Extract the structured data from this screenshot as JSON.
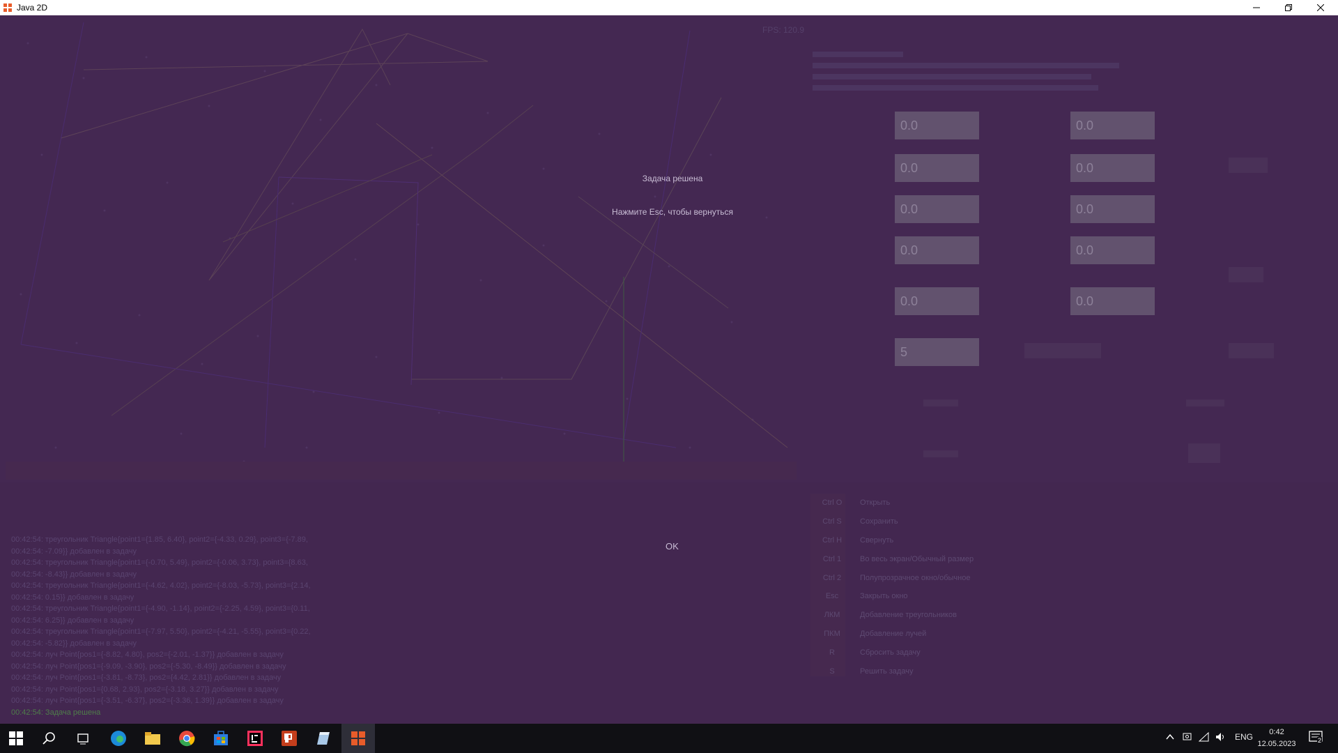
{
  "window": {
    "title": "Java 2D"
  },
  "canvas": {
    "fps": "FPS: 120.9",
    "status_title": "Задача решена",
    "status_hint": "Нажмите Esc, чтобы вернуться",
    "ok_label": "OK"
  },
  "panel": {
    "fields": [
      "0.0",
      "0.0",
      "0.0",
      "0.0",
      "0.0",
      "0.0",
      "0.0",
      "0.0",
      "0.0",
      "0.0",
      "5"
    ]
  },
  "hotkeys": [
    {
      "key": "Ctrl O",
      "desc": "Открыть"
    },
    {
      "key": "Ctrl S",
      "desc": "Сохранить"
    },
    {
      "key": "Ctrl H",
      "desc": "Свернуть"
    },
    {
      "key": "Ctrl 1",
      "desc": "Во весь экран/Обычный размер"
    },
    {
      "key": "Ctrl 2",
      "desc": "Полупрозрачное окно/обычное"
    },
    {
      "key": "Esc",
      "desc": "Закрыть окно"
    },
    {
      "key": "ЛКМ",
      "desc": "Добавление треугольников"
    },
    {
      "key": "ПКМ",
      "desc": "Добавление лучей"
    },
    {
      "key": "R",
      "desc": "Сбросить задачу"
    },
    {
      "key": "S",
      "desc": "Решить задачу"
    }
  ],
  "log": [
    "00:42:54: треугольник Triangle{point1={1.85, 6.40}, point2={-4.33, 0.29}, point3={-7.89,",
    "00:42:54: -7.09}} добавлен в задачу",
    "00:42:54: треугольник Triangle{point1={-0.70, 5.49}, point2={-0.06, 3.73}, point3={8.63,",
    "00:42:54: -8.43}} добавлен в задачу",
    "00:42:54: треугольник Triangle{point1={-4.62, 4.02}, point2={-8.03, -5.73}, point3={2.14,",
    "00:42:54: 0.15}} добавлен в задачу",
    "00:42:54: треугольник Triangle{point1={-4.90, -1.14}, point2={-2.25, 4.59}, point3={0.11,",
    "00:42:54: 6.25}} добавлен в задачу",
    "00:42:54: треугольник Triangle{point1={-7.97, 5.50}, point2={-4.21, -5.55}, point3={0.22,",
    "00:42:54: -5.82}} добавлен в задачу",
    "00:42:54: луч Point{pos1={-8.82, 4.80}, pos2={-2.01, -1.37}} добавлен в задачу",
    "00:42:54: луч Point{pos1={-9.09, -3.90}, pos2={-5.30, -8.49}} добавлен в задачу",
    "00:42:54: луч Point{pos1={-3.81, -8.73}, pos2={4.42, 2.81}} добавлен в задачу",
    "00:42:54: луч Point{pos1={0.68, 2.93}, pos2={-3.18, 3.27}} добавлен в задачу",
    "00:42:54: луч Point{pos1={-3.51, -6.37}, pos2={-3.36, 1.39}} добавлен в задачу",
    "00:42:54: Задача решена"
  ],
  "taskbar": {
    "lang": "ENG",
    "time": "0:42",
    "date": "12.05.2023",
    "notifications": "2",
    "apps": [
      "start-icon",
      "search-icon",
      "task-view-icon",
      "edge-icon",
      "file-explorer-icon",
      "chrome-icon",
      "store-icon",
      "intellij-icon",
      "powerpoint-icon",
      "editor-icon",
      "java-app-icon"
    ]
  },
  "colors": {
    "background": "#442852",
    "dialog_text": "#c8bcd4",
    "field": "#62526e",
    "taskbar": "#101014"
  }
}
